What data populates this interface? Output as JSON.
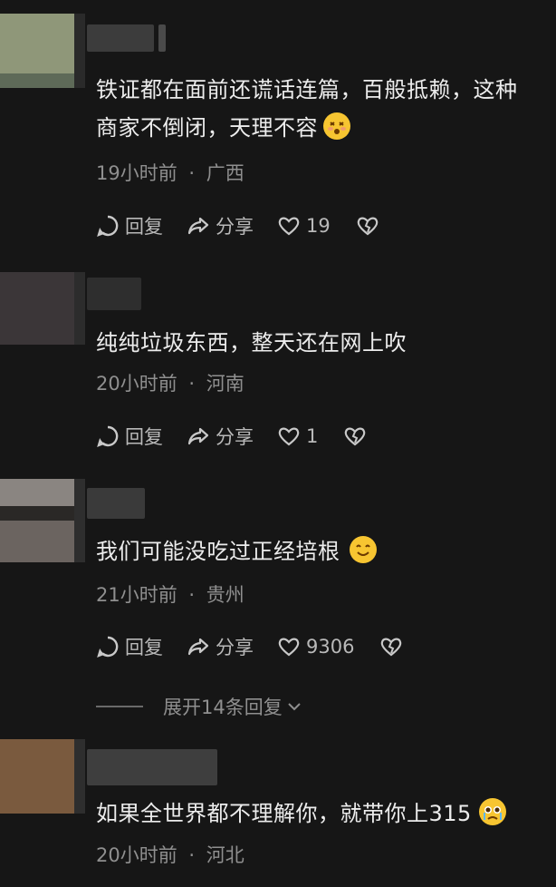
{
  "comments": [
    {
      "text_line1": "铁证都在面前还谎话连篇，百般抵赖，这种",
      "text_line2": "商家不倒闭，天理不容",
      "time": "19小时前",
      "location": "广西",
      "reply_label": "回复",
      "share_label": "分享",
      "likes": "19",
      "emoji": "dizzy-face-emoji"
    },
    {
      "text_line1": "纯纯垃圾东西，整天还在网上吹",
      "time": "20小时前",
      "location": "河南",
      "reply_label": "回复",
      "share_label": "分享",
      "likes": "1"
    },
    {
      "text_line1": "我们可能没吃过正经培根",
      "time": "21小时前",
      "location": "贵州",
      "reply_label": "回复",
      "share_label": "分享",
      "likes": "9306",
      "emoji": "smiling-face-emoji",
      "expand_label": "展开14条回复"
    },
    {
      "text_line1": "如果全世界都不理解你，就带你上315",
      "time": "20小时前",
      "location": "河北",
      "emoji": "crying-face-emoji"
    }
  ],
  "separator": "·",
  "colors": {
    "background": "#161616",
    "text": "#ececec",
    "meta": "#8f8f8f",
    "emoji_yellow": "#f7c531"
  }
}
